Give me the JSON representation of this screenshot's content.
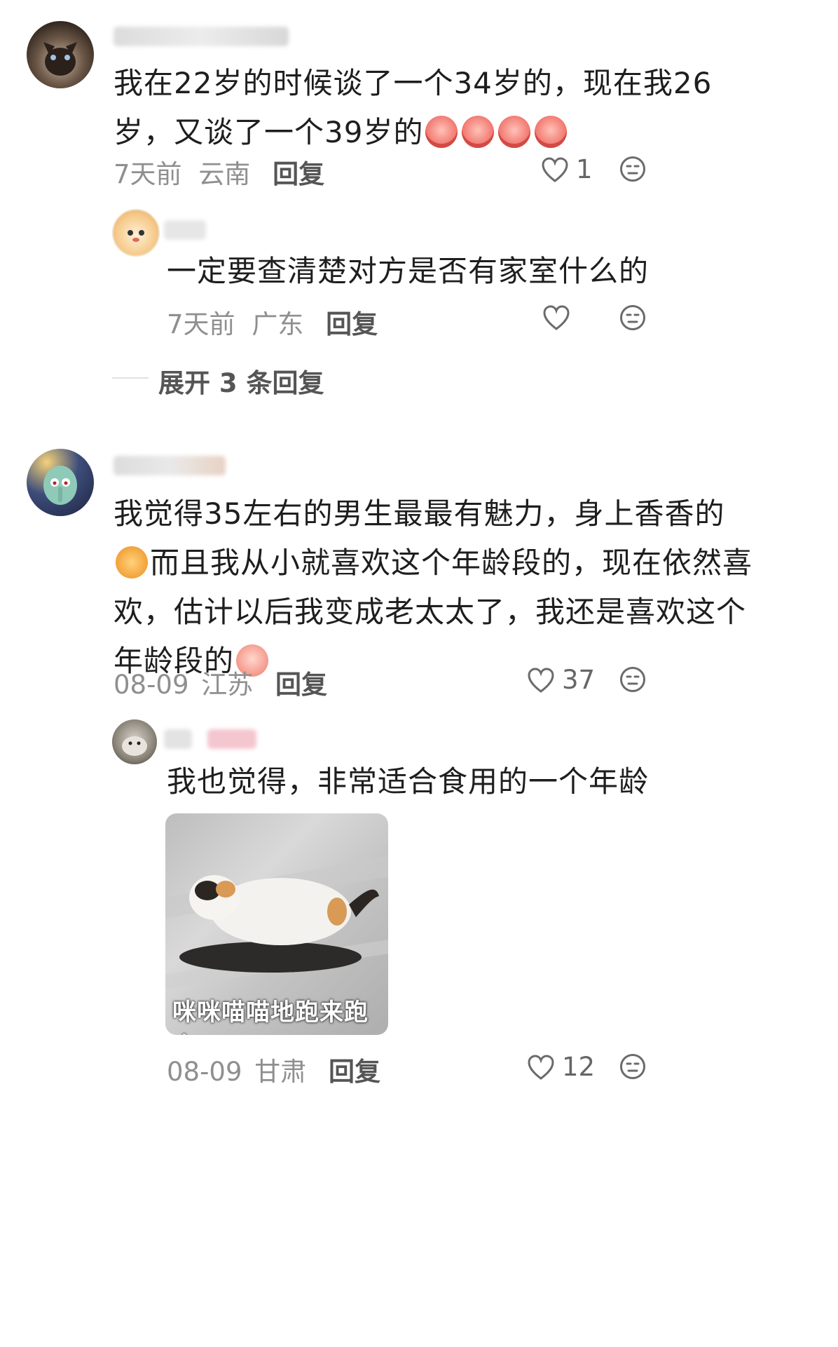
{
  "comments": [
    {
      "text_line1": "我在22岁的时候谈了一个34岁的，现在我26",
      "text_line2": "岁，又谈了一个39岁的",
      "date": "7天前",
      "location": "云南",
      "reply_label": "回复",
      "likes": "1",
      "reply": {
        "text": "一定要查清楚对方是否有家室什么的",
        "date": "7天前",
        "location": "广东",
        "reply_label": "回复",
        "likes": ""
      },
      "expand_label": "展开 3 条回复"
    },
    {
      "text_line1": "我觉得35左右的男生最最有魅力，身上香香的",
      "text_line2": "而且我从小就喜欢这个年龄段的，现在依然喜",
      "text_line3": "欢，估计以后我变成老太太了，我还是喜欢这个",
      "text_line4": "年龄段的",
      "date": "08-09",
      "location": "江苏",
      "reply_label": "回复",
      "likes": "37",
      "reply": {
        "text": "我也觉得，非常适合食用的一个年龄",
        "image_caption": "咪咪喵喵地跑来跑去",
        "date": "08-09",
        "location": "甘肃",
        "reply_label": "回复",
        "likes": "12"
      }
    }
  ],
  "icons": {
    "like": "heart-outline-icon",
    "emoji": "neutral-face-icon"
  },
  "colors": {
    "meta_gray": "#8f8f8f",
    "text": "#1e1e1e"
  }
}
